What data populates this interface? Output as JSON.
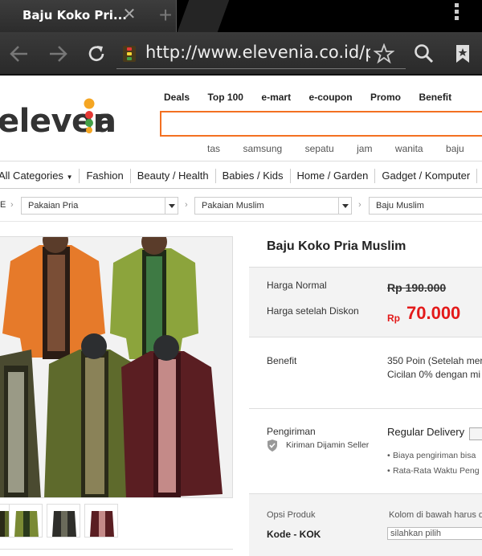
{
  "browser": {
    "tab_title": "Baju Koko Pri...",
    "url": "http://www.elevenia.co.id/prd-l"
  },
  "site": {
    "logo": "elevenia",
    "top_nav": [
      "Deals",
      "Top 100",
      "e-mart",
      "e-coupon",
      "Promo",
      "Benefit"
    ],
    "search_keywords": [
      "tas",
      "samsung",
      "sepatu",
      "jam",
      "wanita",
      "baju"
    ],
    "categories": [
      "All Categories",
      "Fashion",
      "Beauty / Health",
      "Babies / Kids",
      "Home / Garden",
      "Gadget / Komputer",
      "E"
    ],
    "breadcrumb": {
      "home": "E",
      "level1": "Pakaian Pria",
      "level2": "Pakaian Muslim",
      "level3": "Baju Muslim"
    }
  },
  "product": {
    "title": "Baju Koko Pria Muslim",
    "normal_price_label": "Harga Normal",
    "normal_price": "Rp 190.000",
    "discount_label": "Harga setelah Diskon",
    "currency": "Rp",
    "price": "70.000",
    "benefit_label": "Benefit",
    "benefit_line1": "350 Poin (Setelah mer",
    "benefit_line2": "Cicilan 0% dengan mi",
    "shipping_label": "Pengiriman",
    "shipping_guarantee": "Kiriman Dijamin Seller",
    "shipping_method": "Regular Delivery",
    "shipping_note1": "Biaya pengiriman bisa",
    "shipping_note2": "Rata-Rata Waktu Peng",
    "option_label": "Opsi Produk",
    "option_hint": "Kolom di bawah harus d",
    "option_code_label": "Kode - KOK",
    "option_select_placeholder": "silahkan pilih"
  },
  "colors": {
    "accent": "#f37021",
    "price_red": "#e31a1a",
    "logo_yellow": "#f5a623"
  }
}
